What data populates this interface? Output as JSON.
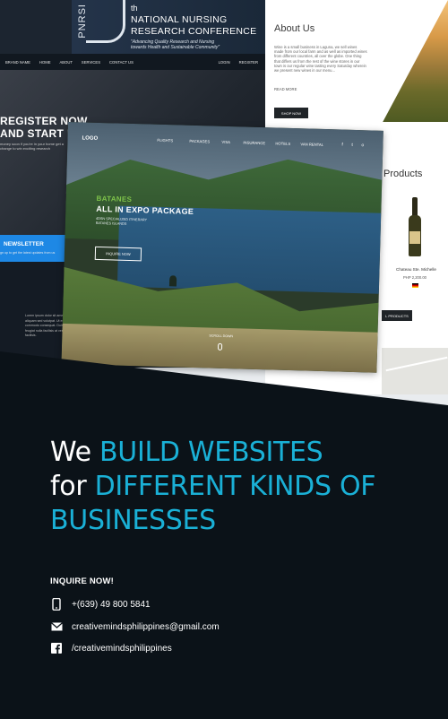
{
  "conference": {
    "brand": "PNRSI",
    "ordinal": "th",
    "title_line1": "NATIONAL NURSING",
    "title_line2": "RESEARCH CONFERENCE",
    "subtitle": "\"Advancing Quality Research and Nursing towards Health and Sustainable Community\"",
    "nav": [
      "BRAND NAME",
      "HOME",
      "ABOUT",
      "SERVICES",
      "CONTACT US",
      "LOGIN",
      "REGISTER"
    ],
    "hero_line1": "REGISTER NOW",
    "hero_line2": "AND START EA",
    "hero_small": "money soon if you're in your home get a change to win exciting research",
    "newsletter": "NEWSLETTER",
    "newsletter_sub": "gn up to get the latest updates from us",
    "footer_text": "Lorem ipsum dolor sit amet aliquam sed volutpat. Ut enim commodo consequat. Duis feugiat nulla facilisis at vero facilisis."
  },
  "wine": {
    "about_title": "About Us",
    "about_text": "Wine is a small business in Laguna, we sell wines made from our local farm and as well as imported wines from different countries, all over the globe. One thing that differs us from the rest of the wine stores in our town is our regular wine tasting every Saturday wherein we present new wines in our menu...",
    "read_more": "READ MORE",
    "shop_now": "SHOP NOW",
    "products_title": "Products",
    "product_name": "Chateau Ste. Michelle",
    "product_price": "PHP 2,200.00",
    "all_products": "L PRODUCTS"
  },
  "travel": {
    "logo": "LOGO",
    "menu": [
      "FLIGHTS",
      "PACKAGES",
      "VISA",
      "INSURANCE",
      "HOTELS",
      "VAN RENTAL"
    ],
    "social": [
      "f",
      "t",
      "o"
    ],
    "destination": "BATANES",
    "package": "ALL IN EXPO PACKAGE",
    "desc": "4DSN SPECIALIZED ITINERARY BATANES ISLANDS",
    "inquire": "INQUIRE NOW",
    "scroll": "SCROLL DOWN"
  },
  "headline": {
    "w1": "We ",
    "a1": "BUILD WEBSITES",
    "w2": "for ",
    "a2": "DIFFERENT KINDS OF BUSINESSES"
  },
  "contact": {
    "heading": "INQUIRE NOW!",
    "phone": "+(639) 49 800 5841",
    "email": "creativemindsphilippines@gmail.com",
    "facebook": "/creativemindsphilippines"
  },
  "colors": {
    "accent": "#1ab0d6",
    "background": "#0b1218"
  },
  "icons": [
    "phone-icon",
    "mail-icon",
    "facebook-icon"
  ]
}
